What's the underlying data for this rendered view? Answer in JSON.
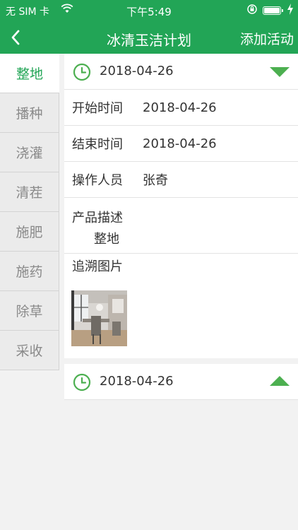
{
  "status": {
    "carrier": "无 SIM 卡",
    "time": "下午5:49"
  },
  "nav": {
    "title": "冰清玉洁计划",
    "action": "添加活动"
  },
  "sidebar": {
    "items": [
      "整地",
      "播种",
      "浇灌",
      "清茬",
      "施肥",
      "施药",
      "除草",
      "采收"
    ],
    "active_index": 0
  },
  "card1": {
    "date": "2018-04-26",
    "start_label": "开始时间",
    "start_value": "2018-04-26",
    "end_label": "结束时间",
    "end_value": "2018-04-26",
    "operator_label": "操作人员",
    "operator_value": "张奇",
    "desc_label": "产品描述",
    "desc_value": "整地",
    "photo_label": "追溯图片"
  },
  "card2": {
    "date": "2018-04-26"
  },
  "colors": {
    "brand": "#22a556",
    "accent": "#4caf50"
  }
}
